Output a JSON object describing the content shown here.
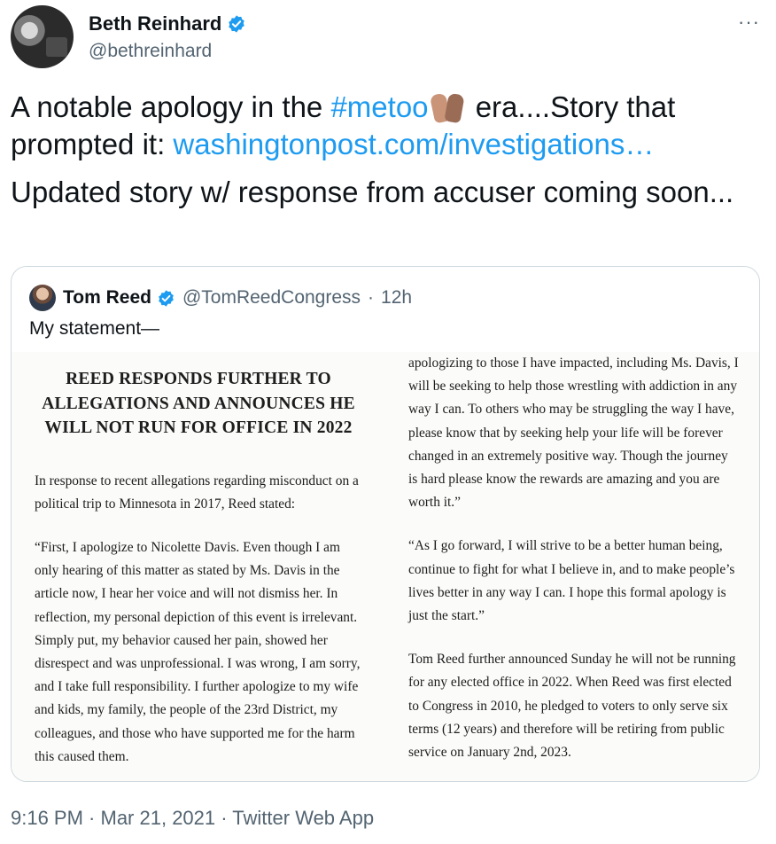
{
  "author": {
    "name": "Beth Reinhard",
    "handle": "@bethreinhard"
  },
  "more_icon": "···",
  "tweet": {
    "line1_pre": "A notable apology in the ",
    "hashtag": "#metoo",
    "line1_post": " era....Story that prompted it:  ",
    "link": "washingtonpost.com/investigations…",
    "para2": "Updated story w/ response from accuser coming soon..."
  },
  "quoted": {
    "name": "Tom Reed",
    "handle": "@TomReedCongress",
    "separator": "·",
    "time": "12h",
    "text": "My statement—",
    "doc": {
      "title": "REED RESPONDS FURTHER TO ALLEGATIONS AND ANNOUNCES HE WILL NOT RUN FOR OFFICE IN 2022",
      "p1": "In response to recent allegations regarding misconduct on a political trip to Minnesota in 2017, Reed stated:",
      "p2": "“First, I apologize to Nicolette Davis. Even though I am only hearing of this matter as stated by Ms. Davis in the article now, I hear her voice and will not dismiss her. In reflection, my personal depiction of this event is irrelevant. Simply put, my behavior caused her pain, showed her disrespect and was unprofessional. I was wrong, I am sorry, and I take full responsibility. I further apologize to my wife and kids, my family, the people of the 23rd District, my colleagues, and those who have supported me for the harm this caused them.",
      "p3": "apologizing to those I have impacted, including Ms. Davis, I will be seeking to help those wrestling with addiction in any way I can. To others who may be struggling the way I have, please know that by seeking help your life will be forever changed in an extremely positive way. Though the journey is hard please know the rewards are amazing and you are worth it.”",
      "p4": "“As I go forward, I will strive to be a better human being, continue to fight for what I believe in, and to make people’s lives better in any way I can. I hope this formal apology is just the start.”",
      "p5": "Tom Reed further announced Sunday he will not be running for any elected office in 2022. When Reed was first elected to Congress in 2010, he pledged to voters to only serve six terms (12 years) and therefore will be retiring from public service on January 2nd, 2023."
    }
  },
  "footer": {
    "time": "9:16 PM",
    "sep": " · ",
    "date": "Mar 21, 2021",
    "app": "Twitter Web App"
  },
  "colors": {
    "link": "#1d9bf0",
    "verified": "#1d9bf0",
    "secondary_text": "#536471"
  }
}
